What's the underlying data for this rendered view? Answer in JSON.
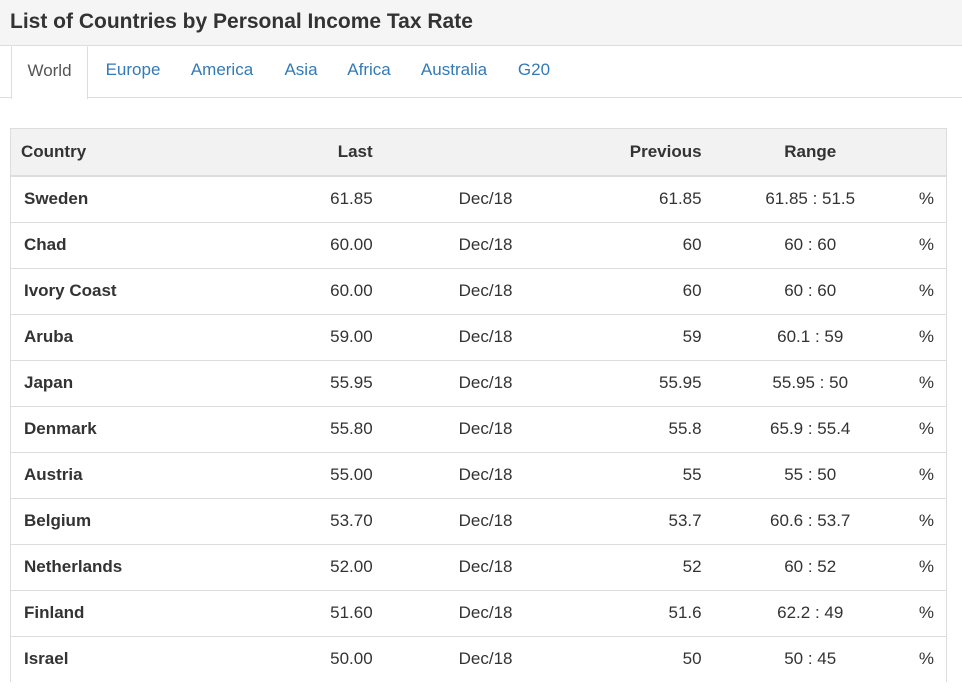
{
  "page": {
    "title": "List of Countries by Personal Income Tax Rate"
  },
  "tabs": [
    {
      "label": "World",
      "active": true
    },
    {
      "label": "Europe",
      "active": false
    },
    {
      "label": "America",
      "active": false
    },
    {
      "label": "Asia",
      "active": false
    },
    {
      "label": "Africa",
      "active": false
    },
    {
      "label": "Australia",
      "active": false
    },
    {
      "label": "G20",
      "active": false
    }
  ],
  "table": {
    "headers": {
      "country": "Country",
      "last": "Last",
      "date": "",
      "previous": "Previous",
      "range": "Range",
      "unit": ""
    },
    "rows": [
      {
        "country": "Sweden",
        "last": "61.85",
        "date": "Dec/18",
        "previous": "61.85",
        "range": "61.85 : 51.5",
        "unit": "%"
      },
      {
        "country": "Chad",
        "last": "60.00",
        "date": "Dec/18",
        "previous": "60",
        "range": "60 : 60",
        "unit": "%"
      },
      {
        "country": "Ivory Coast",
        "last": "60.00",
        "date": "Dec/18",
        "previous": "60",
        "range": "60 : 60",
        "unit": "%"
      },
      {
        "country": "Aruba",
        "last": "59.00",
        "date": "Dec/18",
        "previous": "59",
        "range": "60.1 : 59",
        "unit": "%"
      },
      {
        "country": "Japan",
        "last": "55.95",
        "date": "Dec/18",
        "previous": "55.95",
        "range": "55.95 : 50",
        "unit": "%"
      },
      {
        "country": "Denmark",
        "last": "55.80",
        "date": "Dec/18",
        "previous": "55.8",
        "range": "65.9 : 55.4",
        "unit": "%"
      },
      {
        "country": "Austria",
        "last": "55.00",
        "date": "Dec/18",
        "previous": "55",
        "range": "55 : 50",
        "unit": "%"
      },
      {
        "country": "Belgium",
        "last": "53.70",
        "date": "Dec/18",
        "previous": "53.7",
        "range": "60.6 : 53.7",
        "unit": "%"
      },
      {
        "country": "Netherlands",
        "last": "52.00",
        "date": "Dec/18",
        "previous": "52",
        "range": "60 : 52",
        "unit": "%"
      },
      {
        "country": "Finland",
        "last": "51.60",
        "date": "Dec/18",
        "previous": "51.6",
        "range": "62.2 : 49",
        "unit": "%"
      },
      {
        "country": "Israel",
        "last": "50.00",
        "date": "Dec/18",
        "previous": "50",
        "range": "50 : 45",
        "unit": "%"
      }
    ]
  }
}
